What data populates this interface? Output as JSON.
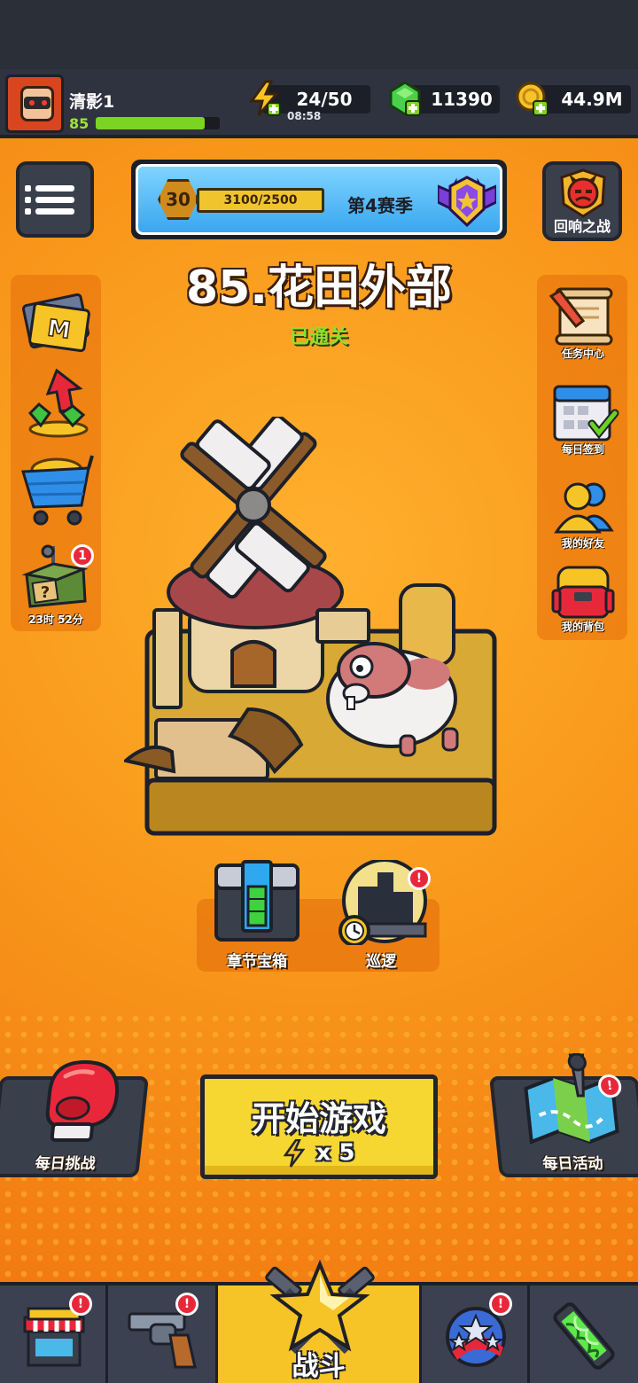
{
  "player": {
    "name": "清影1",
    "level": "85",
    "xp_fraction": 0.88
  },
  "resources": {
    "energy": "24/50",
    "energy_timer": "08:58",
    "gems": "11390",
    "coins": "44.9M"
  },
  "season": {
    "level": "30",
    "progress": "3100/2500",
    "progress_fraction": 1.0,
    "label": "第4赛季"
  },
  "echo_battle": {
    "label": "回响之战"
  },
  "stage": {
    "title": "85.花田外部",
    "status": "已通关"
  },
  "left_side": {
    "timer_label": "23时 52分",
    "chest_badge": "1"
  },
  "right_side": {
    "items": [
      {
        "label": "任务中心"
      },
      {
        "label": "每日签到"
      },
      {
        "label": "我的好友"
      },
      {
        "label": "我的背包"
      }
    ]
  },
  "chapter": {
    "chest_label": "章节宝箱",
    "patrol_label": "巡逻",
    "patrol_badge": "!"
  },
  "actions": {
    "daily_challenge": "每日挑战",
    "start_game": "开始游戏",
    "start_cost": "x 5",
    "daily_events": "每日活动",
    "events_badge": "!"
  },
  "nav": {
    "battle_label": "战斗",
    "alert_badge": "!"
  },
  "colors": {
    "accent": "#f6d630",
    "background": "#f7941d",
    "panel": "#3a3f4c",
    "success": "#8ee02c",
    "alert": "#e8283a"
  }
}
